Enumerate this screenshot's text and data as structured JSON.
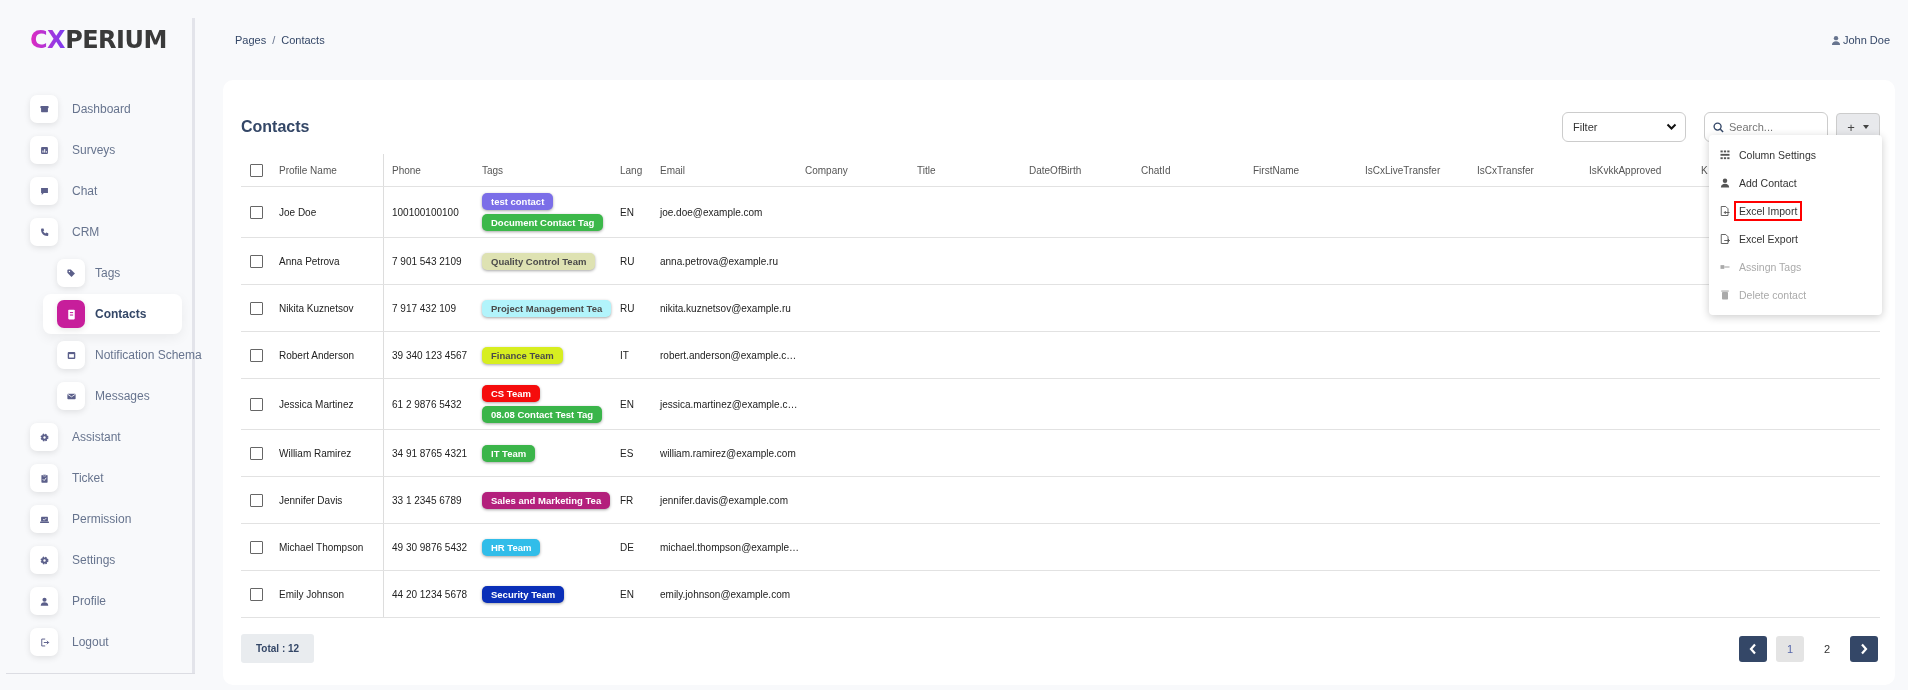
{
  "logo": "CXPERIUM",
  "sidebar": {
    "items": [
      {
        "label": "Dashboard",
        "selected": false
      },
      {
        "label": "Surveys",
        "selected": false
      },
      {
        "label": "Chat",
        "selected": false
      },
      {
        "label": "CRM",
        "selected": false,
        "children": [
          {
            "label": "Tags",
            "selected": false
          },
          {
            "label": "Contacts",
            "selected": true
          },
          {
            "label": "Notification Schema",
            "selected": false
          },
          {
            "label": "Messages",
            "selected": false
          }
        ]
      },
      {
        "label": "Assistant",
        "selected": false
      },
      {
        "label": "Ticket",
        "selected": false
      },
      {
        "label": "Permission",
        "selected": false
      },
      {
        "label": "Settings",
        "selected": false
      },
      {
        "label": "Profile",
        "selected": false
      },
      {
        "label": "Logout",
        "selected": false
      }
    ]
  },
  "breadcrumb": {
    "items": [
      "Pages",
      "Contacts"
    ],
    "separator": "/"
  },
  "user": "John Doe",
  "card": {
    "title": "Contacts",
    "filter": {
      "value": "Filter"
    },
    "search": {
      "placeholder": "Search..."
    },
    "add_button": {
      "label": "+"
    },
    "menu": [
      {
        "label": "Column Settings",
        "disabled": false,
        "highlighted": false
      },
      {
        "label": "Add Contact",
        "disabled": false,
        "highlighted": false
      },
      {
        "label": "Excel Import",
        "disabled": false,
        "highlighted": true
      },
      {
        "label": "Excel Export",
        "disabled": false,
        "highlighted": false
      },
      {
        "label": "Assingn Tags",
        "disabled": true,
        "highlighted": false
      },
      {
        "label": "Delete contact",
        "disabled": true,
        "highlighted": false
      }
    ]
  },
  "table": {
    "select_all_checked": false,
    "columns": [
      "Profile Name",
      "Phone",
      "Tags",
      "Lang",
      "Email",
      "Company",
      "Title",
      "DateOfBirth",
      "ChatId",
      "FirstName",
      "IsCxLiveTransfer",
      "IsCxTransfer",
      "IsKvkkApproved",
      "K"
    ],
    "rows": [
      {
        "checked": false,
        "name": "Joe Doe",
        "phone": "100100100100",
        "tags": [
          {
            "label": "test contact",
            "color": "#7b6ee8"
          },
          {
            "label": "Document Contact Tag",
            "color": "#3cb84a"
          }
        ],
        "lang": "EN",
        "email": "joe.doe@example.com"
      },
      {
        "checked": false,
        "name": "Anna Petrova",
        "phone": "7 901 543 2109",
        "tags": [
          {
            "label": "Quality Control Team",
            "color": "#dee2b2"
          }
        ],
        "lang": "RU",
        "email": "anna.petrova@example.ru"
      },
      {
        "checked": false,
        "name": "Nikita Kuznetsov",
        "phone": "7 917 432 109",
        "tags": [
          {
            "label": "Project Management Tea",
            "color": "#b2f4fb"
          }
        ],
        "lang": "RU",
        "email": "nikita.kuznetsov@example.ru"
      },
      {
        "checked": false,
        "name": "Robert Anderson",
        "phone": "39 340 123 4567",
        "tags": [
          {
            "label": "Finance Team",
            "color": "#d7ee20"
          }
        ],
        "lang": "IT",
        "email": "robert.anderson@example.c…"
      },
      {
        "checked": false,
        "name": "Jessica Martinez",
        "phone": "61 2 9876 5432",
        "tags": [
          {
            "label": "CS Team",
            "color": "#f50c0c"
          },
          {
            "label": "08.08 Contact Test Tag",
            "color": "#3ab54a"
          }
        ],
        "lang": "EN",
        "email": "jessica.martinez@example.c…"
      },
      {
        "checked": false,
        "name": "William Ramirez",
        "phone": "34 91 8765 4321",
        "tags": [
          {
            "label": "IT Team",
            "color": "#3bb54a"
          }
        ],
        "lang": "ES",
        "email": "william.ramirez@example.com"
      },
      {
        "checked": false,
        "name": "Jennifer Davis",
        "phone": "33 1 2345 6789",
        "tags": [
          {
            "label": "Sales and Marketing Tea",
            "color": "#b3207c"
          }
        ],
        "lang": "FR",
        "email": "jennifer.davis@example.com"
      },
      {
        "checked": false,
        "name": "Michael Thompson",
        "phone": "49 30 9876 5432",
        "tags": [
          {
            "label": "HR Team",
            "color": "#31bde9"
          }
        ],
        "lang": "DE",
        "email": "michael.thompson@example…"
      },
      {
        "checked": false,
        "name": "Emily Johnson",
        "phone": "44 20 1234 5678",
        "tags": [
          {
            "label": "Security Team",
            "color": "#0a2fb8"
          }
        ],
        "lang": "EN",
        "email": "emily.johnson@example.com"
      }
    ]
  },
  "total": "Total : 12",
  "pagination": [
    {
      "label": "1",
      "selected": true
    },
    {
      "label": "2",
      "selected": false
    }
  ]
}
